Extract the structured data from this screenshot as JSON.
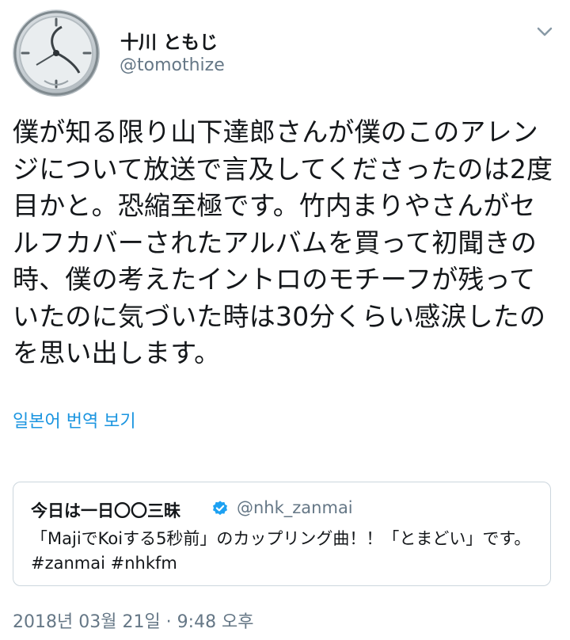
{
  "author": {
    "display_name": "十川 ともじ",
    "handle": "@tomothize",
    "avatar_icon": "avatar-clock-image"
  },
  "caret_icon": "chevron-down-icon",
  "tweet": {
    "text": "僕が知る限り山下達郎さんが僕のこのアレンジについて放送で言及してくださったのは2度目かと。恐縮至極です。竹内まりやさんがセルフカバーされたアルバムを買って初聞きの時、僕の考えたイントロのモチーフが残っていたのに気づいた時は30分くらい感涙したのを思い出します。",
    "translate_label": "일본어 번역 보기",
    "timestamp": "2018년 03월 21일 · 9:48 오후"
  },
  "quoted_tweet": {
    "name": "今日は一日〇〇三昧",
    "verified_icon": "verified-badge-icon",
    "handle": "@nhk_zanmai",
    "text": "「MajiでKoiする5秒前」のカップリング曲！！「とまどい」です。 #zanmai #nhkfm"
  },
  "colors": {
    "link": "#1b95e0",
    "secondary_text": "#657786",
    "border": "#ccd6dd",
    "verified": "#1da1f2"
  }
}
